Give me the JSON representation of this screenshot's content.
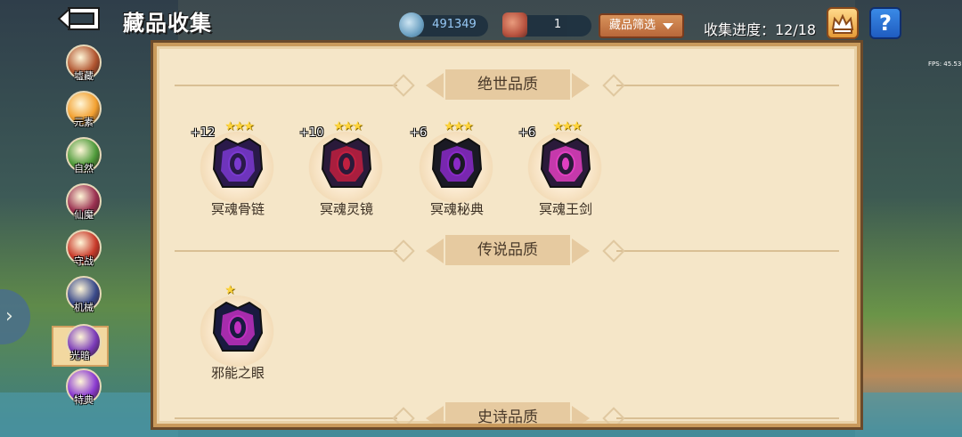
{
  "header": {
    "title": "藏品收集",
    "gem_count": "491349",
    "ore_count": "1",
    "filter_label": "藏品筛选",
    "progress": "收集进度：12/18",
    "help": "?",
    "fps": "FPS: 45.53"
  },
  "sidebar": {
    "items": [
      {
        "label": "墟藏",
        "color": "#b0542f"
      },
      {
        "label": "元素",
        "color": "#f2a030"
      },
      {
        "label": "自然",
        "color": "#4e9a3a"
      },
      {
        "label": "仙魔",
        "color": "#9a3050"
      },
      {
        "label": "守战",
        "color": "#c83a2a"
      },
      {
        "label": "机械",
        "color": "#3a4a8a"
      },
      {
        "label": "光暗",
        "color": "#7a3ab8"
      },
      {
        "label": "特典",
        "color": "#8a3ad0"
      }
    ],
    "active_index": 6
  },
  "sections": [
    {
      "title": "绝世品质",
      "items": [
        {
          "name": "冥魂骨链",
          "level": "+12",
          "stars": "★★★",
          "colors": [
            "#2a1a4a",
            "#7a3ad0"
          ],
          "star_count": 3
        },
        {
          "name": "冥魂灵镜",
          "level": "+10",
          "stars": "★★★",
          "colors": [
            "#2a1a3a",
            "#c02040"
          ],
          "star_count": 3
        },
        {
          "name": "冥魂秘典",
          "level": "+6",
          "stars": "★★★",
          "colors": [
            "#1a1a24",
            "#8a2ac8"
          ],
          "star_count": 3
        },
        {
          "name": "冥魂王剑",
          "level": "+6",
          "stars": "★★★",
          "colors": [
            "#2a1a3a",
            "#e040c0"
          ],
          "star_count": 3
        }
      ]
    },
    {
      "title": "传说品质",
      "items": [
        {
          "name": "邪能之眼",
          "level": "",
          "stars": "★",
          "colors": [
            "#1a1a40",
            "#c030c0"
          ],
          "star_count": 1
        }
      ]
    },
    {
      "title": "史诗品质",
      "items": []
    }
  ]
}
